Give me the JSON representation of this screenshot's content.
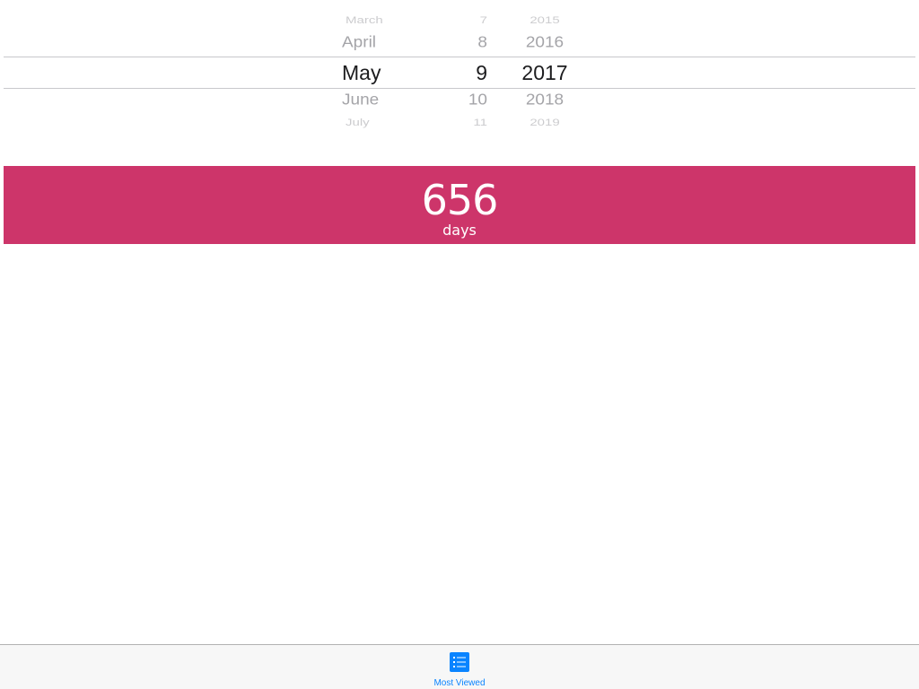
{
  "picker": {
    "months": [
      "March",
      "April",
      "May",
      "June",
      "July"
    ],
    "days": [
      "7",
      "8",
      "9",
      "10",
      "11"
    ],
    "years": [
      "2015",
      "2016",
      "2017",
      "2018",
      "2019"
    ],
    "selected": {
      "month": "May",
      "day": "9",
      "year": "2017"
    }
  },
  "result": {
    "value": "656",
    "unit": "days",
    "background_color": "#cd356a"
  },
  "tabbar": {
    "tabs": [
      {
        "label": "Most Viewed",
        "icon": "list-icon",
        "active": true
      }
    ],
    "accent_color": "#0a84ff"
  }
}
